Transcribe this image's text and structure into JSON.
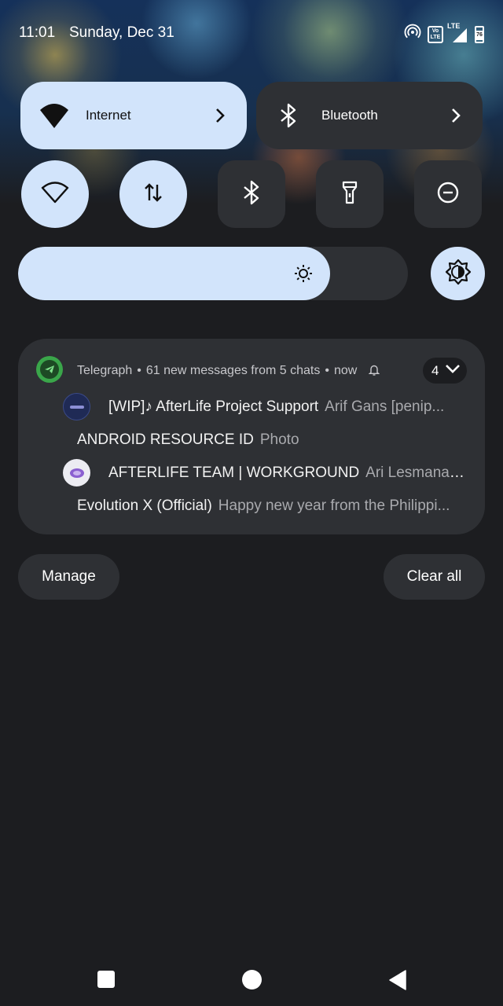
{
  "status_bar": {
    "time": "11:01",
    "date": "Sunday, Dec 31",
    "icons": [
      "hotspot-icon",
      "volte-icon",
      "signal-lte-icon",
      "battery-icon"
    ],
    "volte_label": "Vo LTE",
    "lte_label": "LTE",
    "battery_level": "76"
  },
  "quick_settings": {
    "internet_tile": {
      "label": "Internet",
      "icon": "wifi-filled-icon",
      "active": true
    },
    "bluetooth_tile": {
      "label": "Bluetooth",
      "icon": "bluetooth-icon",
      "active": false
    },
    "small_tiles": [
      {
        "name": "wifi",
        "icon": "wifi-icon",
        "active": true
      },
      {
        "name": "mobile-data",
        "icon": "data-transfer-icon",
        "active": true
      },
      {
        "name": "bluetooth",
        "icon": "bluetooth-icon",
        "active": false
      },
      {
        "name": "flashlight",
        "icon": "flashlight-icon",
        "active": false
      },
      {
        "name": "do-not-disturb",
        "icon": "dnd-icon",
        "active": false
      }
    ],
    "brightness_level": 0.8,
    "auto_brightness_active": true
  },
  "notification": {
    "app_name": "Telegraph",
    "summary": "61 new messages from 5 chats",
    "time": "now",
    "count": "4",
    "messages": [
      {
        "title": "[WIP]♪ AfterLife Project Support",
        "text": "Arif Gans [penip..."
      },
      {
        "title": "ANDROID RESOURCE ID",
        "text": "Photo"
      },
      {
        "title": "AFTERLIFE TEAM | WORKGROUND",
        "text": "Ari Lesmana: ..."
      },
      {
        "title": "Evolution X (Official)",
        "text": "Happy new year from the Philippi..."
      }
    ]
  },
  "actions": {
    "manage_label": "Manage",
    "clear_all_label": "Clear all"
  },
  "colors": {
    "active_tile": "#d2e4fb",
    "inactive_tile": "#2e3034",
    "background": "#1c1d20",
    "telegraph_green": "#3aa64a"
  }
}
